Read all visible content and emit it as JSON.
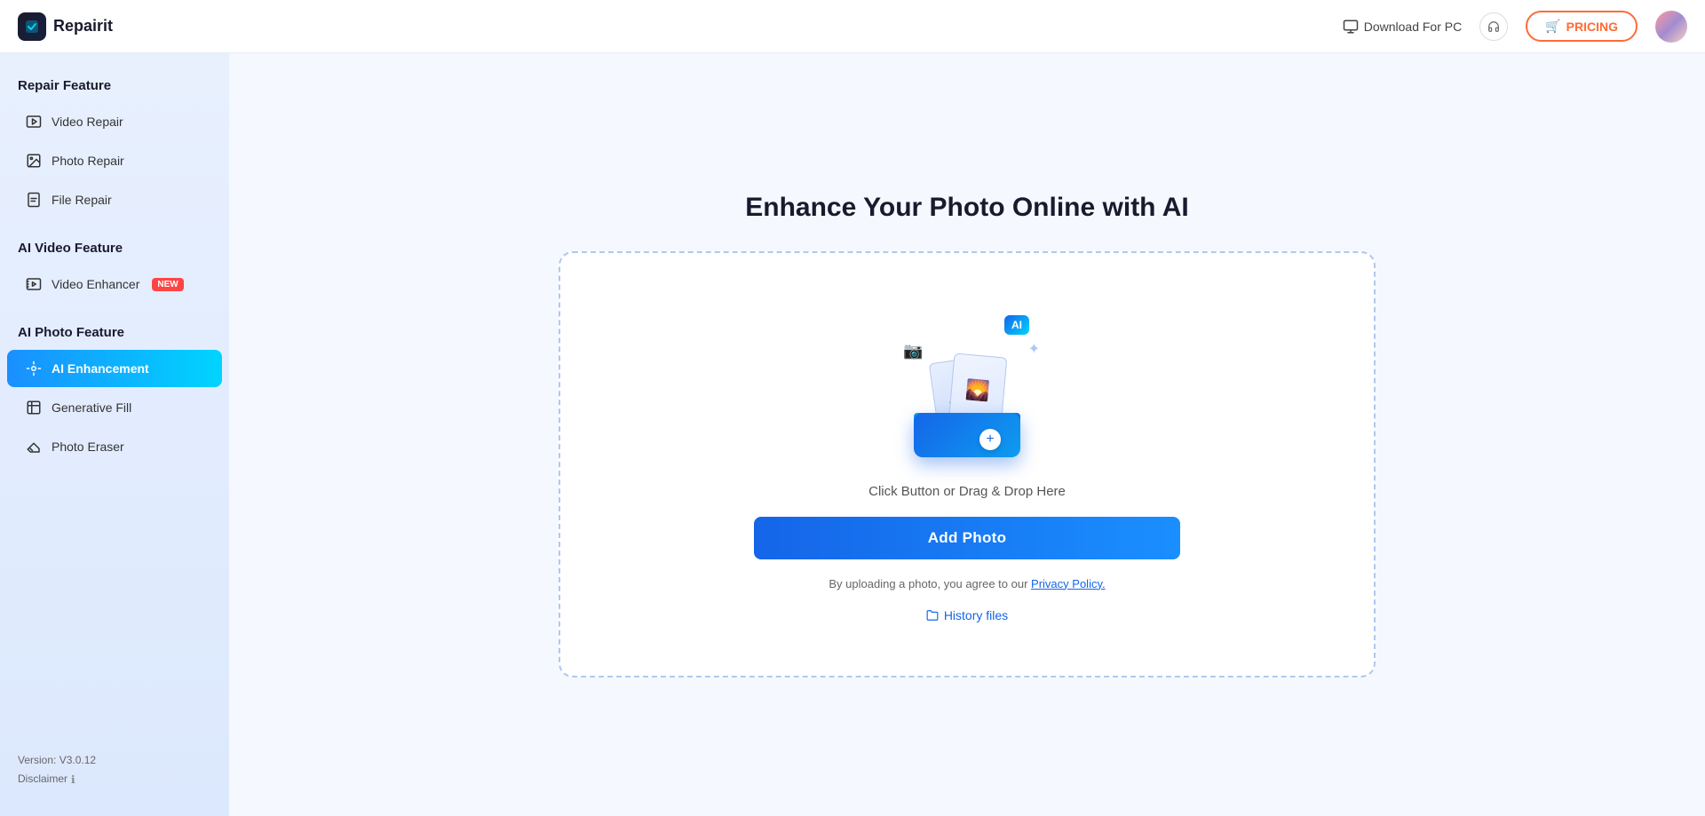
{
  "header": {
    "logo_text": "Repairit",
    "download_label": "Download For PC",
    "pricing_label": "PRICING",
    "pricing_icon": "🛒"
  },
  "sidebar": {
    "sections": [
      {
        "title": "Repair Feature",
        "items": [
          {
            "id": "video-repair",
            "label": "Video Repair",
            "icon": "video",
            "active": false,
            "badge": null
          },
          {
            "id": "photo-repair",
            "label": "Photo Repair",
            "icon": "photo",
            "active": false,
            "badge": null
          },
          {
            "id": "file-repair",
            "label": "File Repair",
            "icon": "file",
            "active": false,
            "badge": null
          }
        ]
      },
      {
        "title": "AI Video Feature",
        "items": [
          {
            "id": "video-enhancer",
            "label": "Video Enhancer",
            "icon": "enhance-video",
            "active": false,
            "badge": "NEW"
          }
        ]
      },
      {
        "title": "AI Photo Feature",
        "items": [
          {
            "id": "ai-enhancement",
            "label": "AI Enhancement",
            "icon": "ai",
            "active": true,
            "badge": null
          },
          {
            "id": "generative-fill",
            "label": "Generative Fill",
            "icon": "fill",
            "active": false,
            "badge": null
          },
          {
            "id": "photo-eraser",
            "label": "Photo Eraser",
            "icon": "eraser",
            "active": false,
            "badge": null
          }
        ]
      }
    ],
    "footer": {
      "version": "Version: V3.0.12",
      "disclaimer": "Disclaimer"
    }
  },
  "main": {
    "title": "Enhance Your Photo Online with AI",
    "drop_hint": "Click Button or Drag & Drop Here",
    "add_photo_label": "Add Photo",
    "privacy_text": "By uploading a photo, you agree to our ",
    "privacy_link_text": "Privacy Policy.",
    "history_label": "History files"
  },
  "colors": {
    "accent": "#1565e8",
    "accent_light": "#1a8fff",
    "pricing": "#ff6b35",
    "sidebar_bg_start": "#e8f0fe",
    "sidebar_bg_end": "#dce8fd",
    "active_gradient_start": "#1a8fff",
    "active_gradient_end": "#00d4ff",
    "new_badge": "#ff4444"
  }
}
